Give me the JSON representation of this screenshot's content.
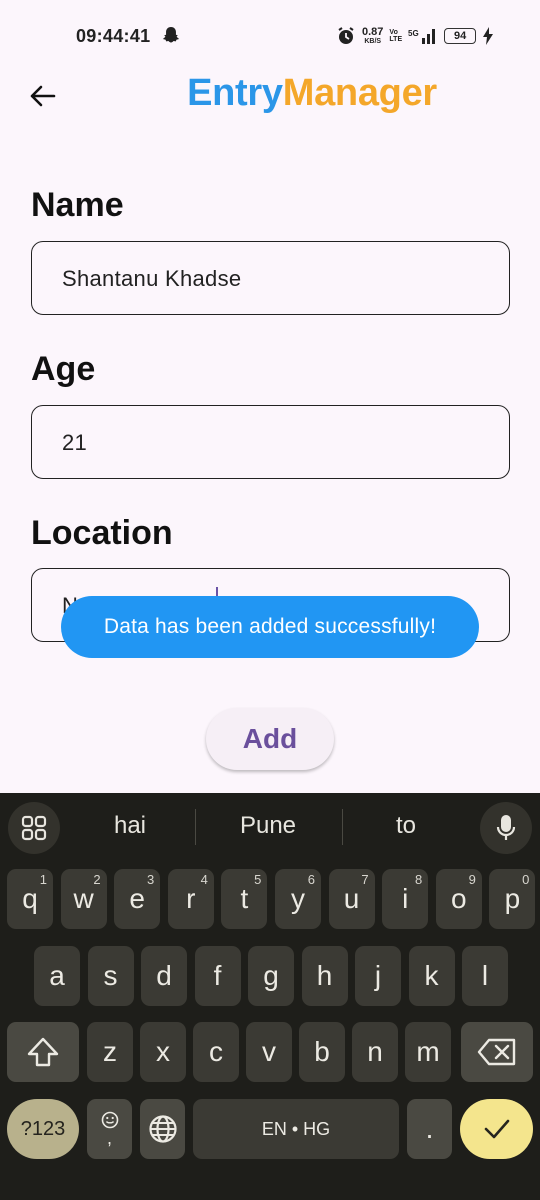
{
  "status_bar": {
    "time": "09:44:41",
    "net_speed_value": "0.87",
    "net_speed_unit": "KB/S",
    "volte_top": "Vo",
    "volte_bottom": "LTE",
    "signal_label": "5G",
    "battery": "94"
  },
  "app_bar": {
    "back_icon": "arrow-left-icon",
    "title_part1": "Entry",
    "title_part2": "Manager",
    "title_color1": "#2b96e8",
    "title_color2": "#f4a72a"
  },
  "form": {
    "name_label": "Name",
    "name_value": "Shantanu Khadse",
    "age_label": "Age",
    "age_value": "21",
    "location_label": "Location",
    "location_value": "N"
  },
  "toast": {
    "message": "Data has been added successfully!",
    "color": "#2196f3"
  },
  "add_button": {
    "label": "Add"
  },
  "keyboard": {
    "suggestions": [
      "hai",
      "Pune",
      "to"
    ],
    "row1": [
      {
        "key": "q",
        "hint": "1"
      },
      {
        "key": "w",
        "hint": "2"
      },
      {
        "key": "e",
        "hint": "3"
      },
      {
        "key": "r",
        "hint": "4"
      },
      {
        "key": "t",
        "hint": "5"
      },
      {
        "key": "y",
        "hint": "6"
      },
      {
        "key": "u",
        "hint": "7"
      },
      {
        "key": "i",
        "hint": "8"
      },
      {
        "key": "o",
        "hint": "9"
      },
      {
        "key": "p",
        "hint": "0"
      }
    ],
    "row2": [
      "a",
      "s",
      "d",
      "f",
      "g",
      "h",
      "j",
      "k",
      "l"
    ],
    "row3": [
      "z",
      "x",
      "c",
      "v",
      "b",
      "n",
      "m"
    ],
    "symbols_label": "?123",
    "emoji_comma": ",",
    "space_label": "EN • HG",
    "period": "."
  }
}
